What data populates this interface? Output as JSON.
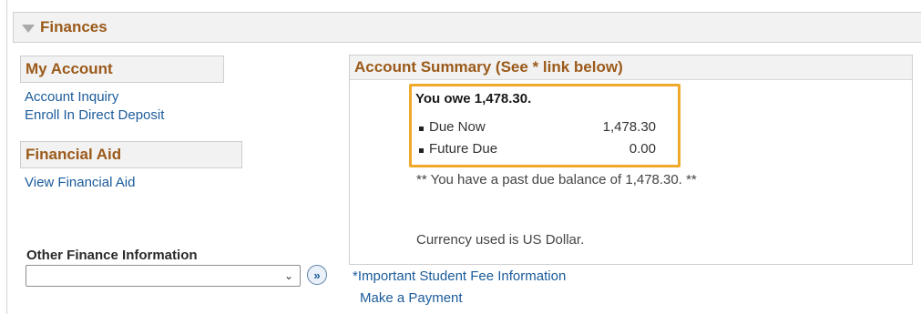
{
  "finances": {
    "title": "Finances"
  },
  "my_account": {
    "title": "My Account",
    "links": [
      "Account Inquiry",
      "Enroll In Direct Deposit"
    ]
  },
  "financial_aid": {
    "title": "Financial Aid",
    "links": [
      "View Financial Aid"
    ]
  },
  "other_finance": {
    "label": "Other Finance Information",
    "selected": "",
    "go_label": "»"
  },
  "account_summary": {
    "title": "Account Summary (See * link below)",
    "owe_text": "You owe 1,478.30.",
    "rows": [
      {
        "label": "Due Now",
        "value": "1,478.30"
      },
      {
        "label": "Future Due",
        "value": "0.00"
      }
    ],
    "past_due_text": "** You have a past due balance of 1,478.30. **",
    "currency_text": "Currency used is US Dollar."
  },
  "bottom_links": {
    "important": "*Important Student Fee Information",
    "payment": "Make a Payment"
  },
  "colors": {
    "section_title": "#9b5a1a",
    "link": "#1b5b9b",
    "highlight": "#f0a92a"
  }
}
